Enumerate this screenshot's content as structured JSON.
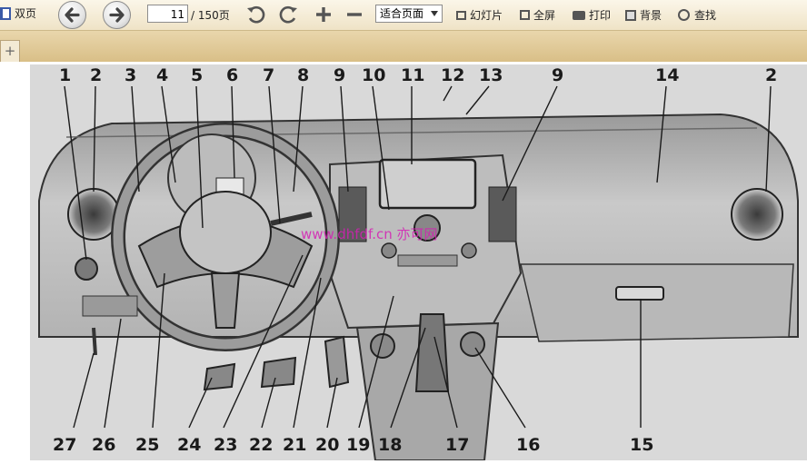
{
  "toolbar": {
    "dual_page_label": "双页",
    "page_current": "11",
    "page_total": "/ 150页",
    "zoom_select": "适合页面",
    "slideshow_label": "幻灯片",
    "fullscreen_label": "全屏",
    "print_label": "打印",
    "background_label": "背景",
    "find_label": "查找"
  },
  "tabs": {
    "add_label": "+"
  },
  "document": {
    "watermark": "www.dhfdf.cn 亦可网",
    "callouts_top": [
      "1",
      "2",
      "3",
      "4",
      "5",
      "6",
      "7",
      "8",
      "9",
      "10",
      "11",
      "12",
      "13",
      "9",
      "14",
      "2"
    ],
    "callouts_bottom": [
      "27",
      "26",
      "25",
      "24",
      "23",
      "22",
      "21",
      "20",
      "19",
      "18",
      "17",
      "16",
      "15"
    ]
  }
}
